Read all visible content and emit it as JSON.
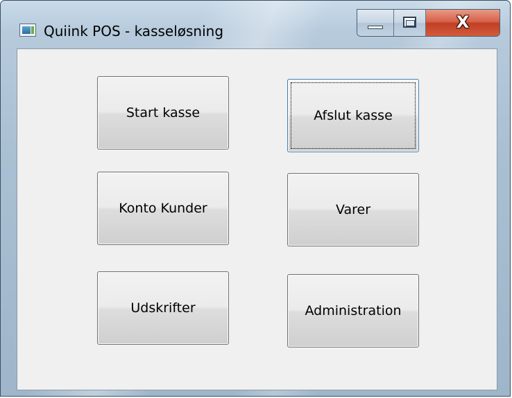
{
  "window": {
    "title": "Quiink POS - kasseløsning",
    "icon": "app-window-icon",
    "caption_buttons": {
      "minimize_icon": "minimize-icon",
      "maximize_icon": "maximize-icon",
      "close_label": "X"
    }
  },
  "main": {
    "buttons": [
      {
        "label": "Start kasse"
      },
      {
        "label": "Afslut kasse"
      },
      {
        "label": "Konto Kunder"
      },
      {
        "label": "Varer"
      },
      {
        "label": "Udskrifter"
      },
      {
        "label": "Administration"
      }
    ]
  },
  "colors": {
    "client_background": "#f0f0f0",
    "close_button": "#c13f24",
    "focus_border": "#3c7fb1"
  }
}
